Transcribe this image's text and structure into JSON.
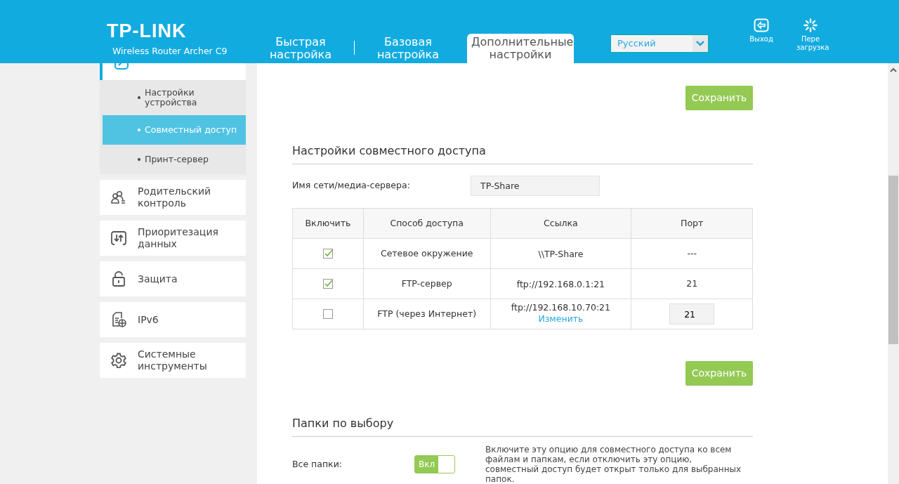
{
  "header": {
    "logo": "TP-LINK",
    "model": "Wireless Router Archer C9",
    "tabs": [
      {
        "label": "Быстрая настройка",
        "selected": false
      },
      {
        "label": "Базовая настройка",
        "selected": false
      },
      {
        "label": "Дополнительные настройки",
        "selected": true
      }
    ],
    "language": "Русский",
    "actions": [
      {
        "kind": "logout",
        "label": "Выход"
      },
      {
        "kind": "reboot",
        "label": "Пере загрузка"
      }
    ]
  },
  "sidebar": {
    "items": [
      {
        "kind": "usb",
        "selected": true,
        "children": [
          {
            "label": "Настройки устройства",
            "selected": false
          },
          {
            "label": "Совместный доступ",
            "selected": true
          },
          {
            "label": "Принт-сервер",
            "selected": false
          }
        ]
      },
      {
        "kind": "parental",
        "label": "Родительский контроль",
        "selected": false
      },
      {
        "kind": "qos",
        "label": "Приоритезация данных",
        "selected": false
      },
      {
        "kind": "security",
        "label": "Защита",
        "selected": false
      },
      {
        "kind": "ipv6",
        "label": "IPv6",
        "selected": false
      },
      {
        "kind": "tools",
        "label": "Системные инструменты",
        "selected": false
      }
    ]
  },
  "main": {
    "save_top": "Сохранить",
    "sharing": {
      "title": "Настройки совместного доступа",
      "field_label": "Имя сети/медиа-сервера:",
      "field_value": "TP-Share",
      "table": {
        "columns": [
          "Включить",
          "Способ доступа",
          "Ссылка",
          "Порт"
        ],
        "rows": [
          {
            "checked": true,
            "method": "Сетевое окружение",
            "link": "\\\\TP-Share",
            "port": "---",
            "port_editable": false
          },
          {
            "checked": true,
            "method": "FTP-сервер",
            "link": "ftp://192.168.0.1:21",
            "port": "21",
            "port_editable": false
          },
          {
            "checked": false,
            "method": "FTP (через Интернет)",
            "link": "ftp://192.168.10.70:21",
            "link_action": "Изменить",
            "port": "21",
            "port_editable": true
          }
        ]
      }
    },
    "save_bottom": "Сохранить",
    "folders": {
      "title": "Папки по выбору",
      "label": "Все папки:",
      "toggle_on": true,
      "toggle_label": "Вкл",
      "description": "Включите эту опцию для совместного доступа ко всем файлам и папкам, если отключить эту опцию, совместный доступ будет открыт только для выбранных папок."
    }
  }
}
